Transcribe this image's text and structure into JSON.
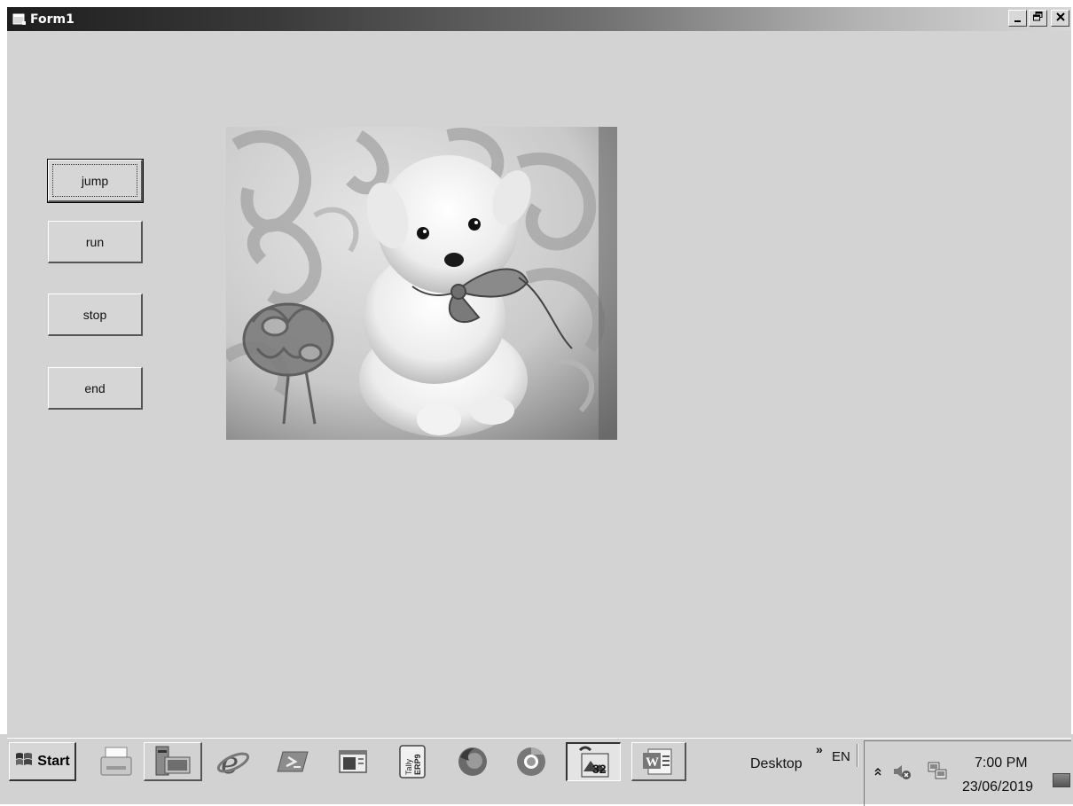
{
  "window": {
    "title": "Form1",
    "controls": {
      "minimize": "_",
      "restore": "🗗",
      "close": "✕"
    }
  },
  "form": {
    "buttons": [
      {
        "label": "jump",
        "focused": true
      },
      {
        "label": "run",
        "focused": false
      },
      {
        "label": "stop",
        "focused": false
      },
      {
        "label": "end",
        "focused": false
      }
    ],
    "picture": {
      "subject": "white puppy on patterned blanket"
    }
  },
  "taskbar": {
    "start_label": "Start",
    "apps": [
      {
        "name": "printer-icon"
      },
      {
        "name": "computer-icon"
      },
      {
        "name": "internet-explorer-icon"
      },
      {
        "name": "powershell-icon"
      },
      {
        "name": "window-app-icon"
      },
      {
        "name": "tally-erp-icon",
        "text": "Tally ERP9"
      },
      {
        "name": "firefox-icon"
      },
      {
        "name": "chrome-icon"
      },
      {
        "name": "vb-project-icon",
        "text": "32"
      },
      {
        "name": "word-icon",
        "text": "W"
      }
    ],
    "desktop_label": "Desktop",
    "toolbar_chevron": "»",
    "language": "EN",
    "tray": {
      "expand": "⌃",
      "clock_time": "7:00 PM",
      "clock_date": "23/06/2019"
    }
  }
}
